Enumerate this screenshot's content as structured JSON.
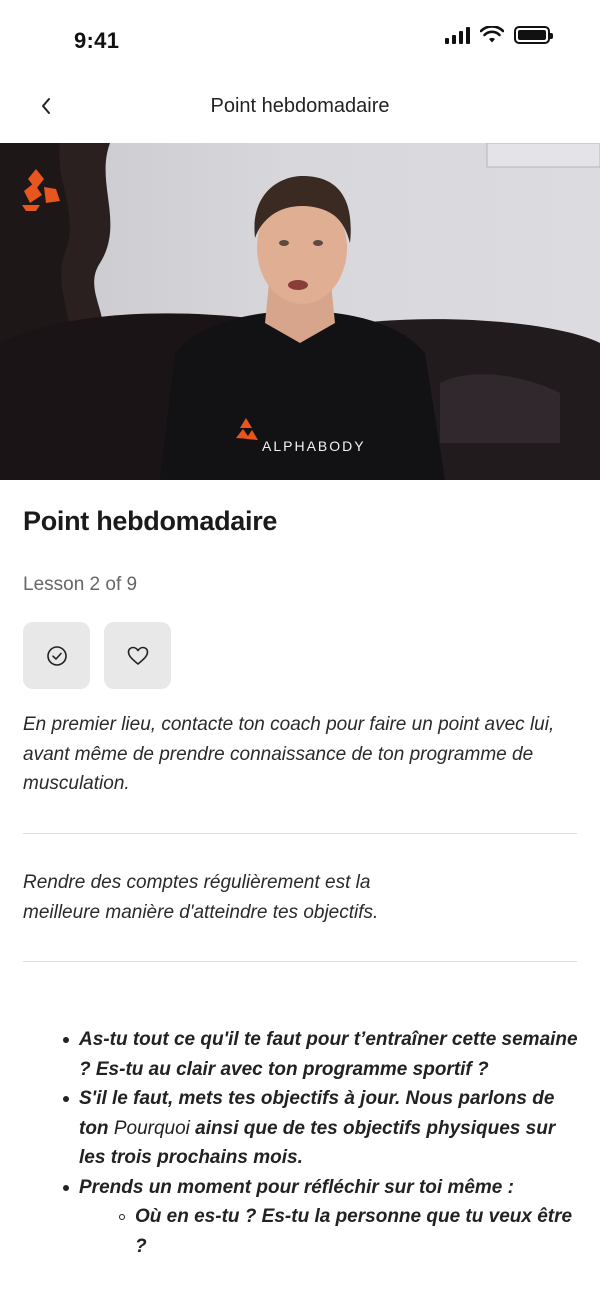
{
  "status_bar": {
    "time": "9:41"
  },
  "nav": {
    "title": "Point hebdomadaire",
    "back_icon": "chevron-left-icon"
  },
  "video": {
    "shirt_brand": "ALPHABODY",
    "logo": "alphabody-logo"
  },
  "lesson": {
    "title": "Point hebdomadaire",
    "progress": "Lesson 2 of 9",
    "actions": [
      {
        "icon": "check-circle-icon"
      },
      {
        "icon": "heart-icon"
      }
    ],
    "intro": "En premier lieu, contacte ton coach pour faire un point avec lui, avant même de prendre connaissance de ton programme de musculation.",
    "quote_line1": "Rendre des comptes régulièrement est la",
    "quote_line2": "meilleure manière d'atteindre tes objectifs.",
    "bullets": {
      "b1": "As-tu tout ce qu'il te faut pour t’entraîner cette semaine ? Es-tu au clair avec ton programme sportif ?",
      "b2_part1": "S'il le faut, mets tes objectifs à jour. Nous parlons de ton ",
      "b2_part2": "Pourquoi",
      "b2_part3": " ainsi que de tes objectifs physiques sur les trois prochains mois.",
      "b3": "Prends un moment pour réfléchir sur toi même :",
      "b3_sub1": "Où en es-tu ? Es-tu la personne que tu veux être ?"
    }
  }
}
